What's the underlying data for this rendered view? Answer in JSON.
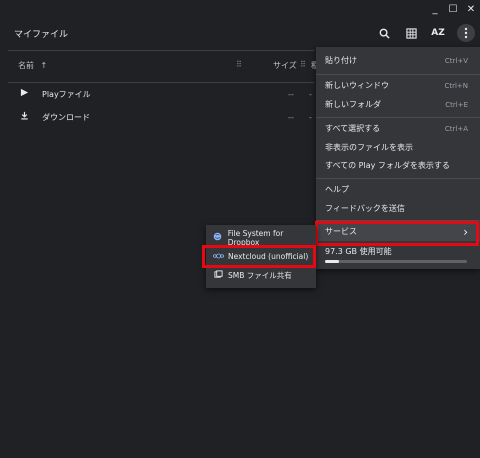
{
  "window": {
    "minimize": "_",
    "maximize": "☐",
    "close": "✕"
  },
  "toolbar": {
    "title": "マイファイル",
    "search_icon": "search-icon",
    "grid_icon": "grid-view-icon",
    "sort_label": "AZ",
    "more_icon": "more-vert-icon"
  },
  "columns": {
    "name": "名前",
    "sort_arrow": "↑",
    "size": "サイズ",
    "col_icon": "⠿",
    "type_trunc": "種"
  },
  "files": [
    {
      "label": "Playファイル",
      "icon": "play-icon",
      "size": "--",
      "type_trunc": "-"
    },
    {
      "label": "ダウンロード",
      "icon": "download-icon",
      "size": "--",
      "type_trunc": "-"
    }
  ],
  "menu": {
    "paste": {
      "label": "貼り付け",
      "shortcut": "Ctrl+V"
    },
    "new_window": {
      "label": "新しいウィンドウ",
      "shortcut": "Ctrl+N"
    },
    "new_folder": {
      "label": "新しいフォルダ",
      "shortcut": "Ctrl+E"
    },
    "select_all": {
      "label": "すべて選択する",
      "shortcut": "Ctrl+A"
    },
    "show_hidden": {
      "label": "非表示のファイルを表示"
    },
    "show_play": {
      "label": "すべての Play フォルダを表示する"
    },
    "help": {
      "label": "ヘルプ"
    },
    "feedback": {
      "label": "フィードバックを送信"
    },
    "services": {
      "label": "サービス",
      "arrow": "›"
    },
    "storage": {
      "label": "97.3 GB 使用可能",
      "fill_fraction": 0.1
    }
  },
  "submenu": {
    "dropbox": {
      "label": "File System for Dropbox",
      "icon": "dropbox-globe-icon"
    },
    "nextcloud": {
      "label": "Nextcloud (unofficial)",
      "icon": "nextcloud-icon"
    },
    "smb": {
      "label": "SMB ファイル共有",
      "icon": "smb-share-icon"
    }
  },
  "colors": {
    "highlight": "#e50914",
    "background": "#202124",
    "menu": "#35363a"
  }
}
